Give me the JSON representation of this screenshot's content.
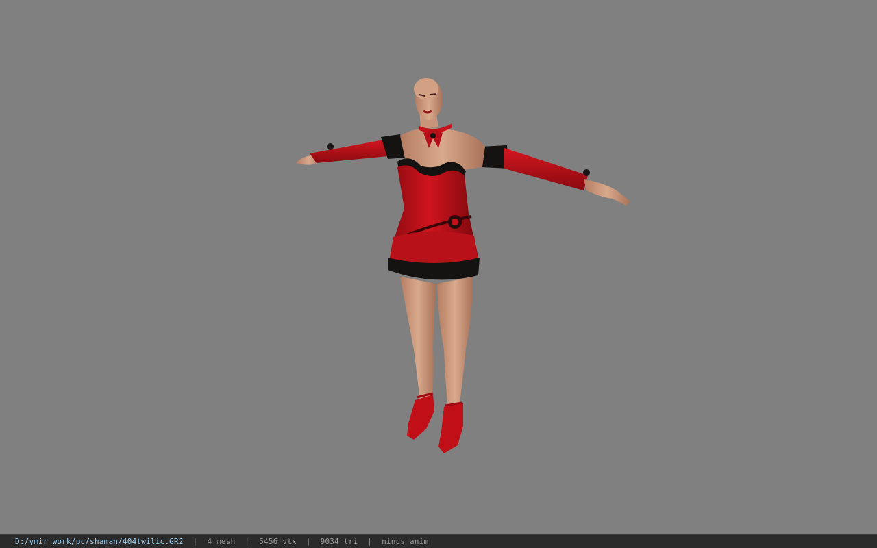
{
  "window": {
    "background_color": "#808080"
  },
  "viewport": {
    "model_name": "character-model",
    "colors": {
      "dress": "#c8101a",
      "dress_dark": "#8a0a10",
      "trim": "#151212",
      "skin": "#d7a487",
      "skin_shadow": "#b57e63",
      "shoe": "#c10f18"
    }
  },
  "status_bar": {
    "file_path": "D:/ymir work/pc/shaman/404twilic.GR2",
    "separator": "|",
    "mesh_count": "4 mesh",
    "vertex_count": "5456 vtx",
    "triangle_count": "9034 tri",
    "animation": "nincs anim"
  }
}
